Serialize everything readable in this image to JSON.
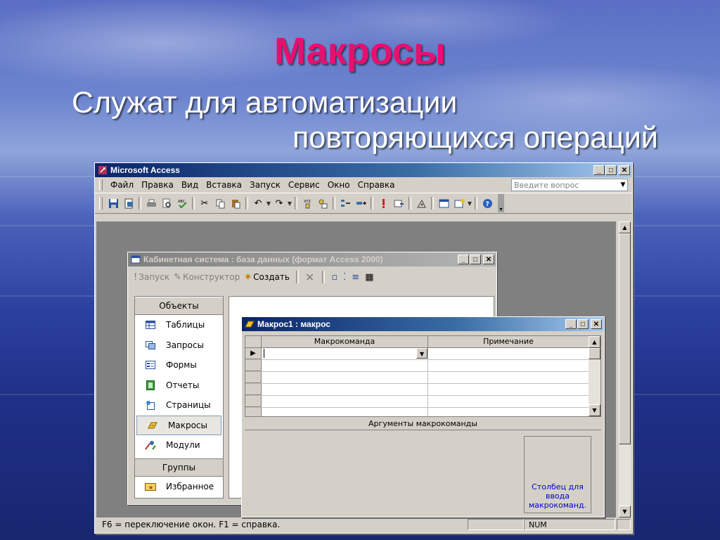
{
  "slide": {
    "title": "Макросы",
    "subtitle_line1": "Служат для автоматизации",
    "subtitle_line2": "повторяющихся операций"
  },
  "app": {
    "title": "Microsoft Access",
    "menu": [
      "Файл",
      "Правка",
      "Вид",
      "Вставка",
      "Запуск",
      "Сервис",
      "Окно",
      "Справка"
    ],
    "ask_placeholder": "Введите вопрос",
    "status_left": "F6 = переключение окон.  F1 = справка.",
    "status_num": "NUM"
  },
  "db_window": {
    "title": "Кабинетная система : база данных (формат Access 2000)",
    "toolbar": {
      "run": "Запуск",
      "design": "Конструктор",
      "create": "Создать"
    },
    "objects_header": "Объекты",
    "objects": [
      "Таблицы",
      "Запросы",
      "Формы",
      "Отчеты",
      "Страницы",
      "Макросы",
      "Модули"
    ],
    "selected_object": "Макросы",
    "groups_header": "Группы",
    "groups": [
      "Избранное"
    ]
  },
  "macro_window": {
    "title": "Макрос1 : макрос",
    "columns": [
      "Макрокоманда",
      "Примечание"
    ],
    "args_label": "Аргументы макрокоманды",
    "hint": "Столбец для ввода макрокоманд."
  },
  "colors": {
    "title_accent": "#e8106e",
    "titlebar_active": "#0a246a",
    "window_face": "#d4d0c8",
    "hint_text": "#0000c8"
  }
}
